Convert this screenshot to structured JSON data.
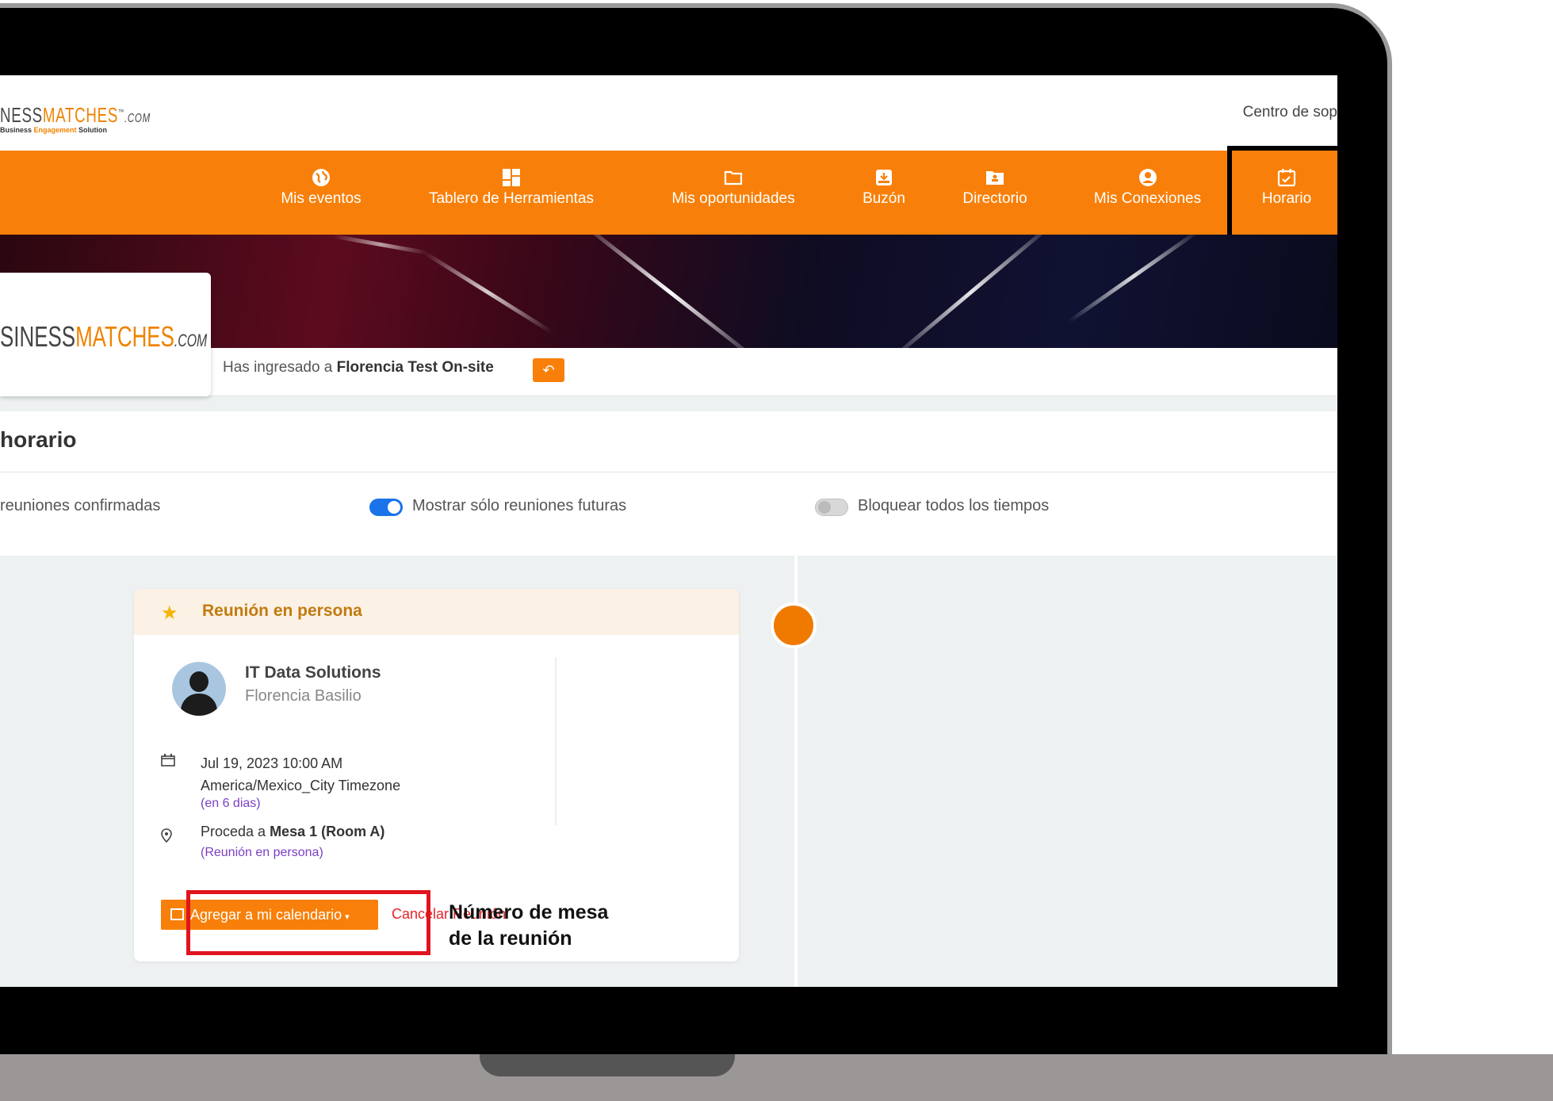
{
  "header": {
    "logo_left": "NESS",
    "logo_right": "MATCHES",
    "logo_tm": "™",
    "logo_com": ".COM",
    "logo_tagline_a": "Business ",
    "logo_tagline_b": "Engagement",
    "logo_tagline_c": " Solution",
    "support_link": "Centro de sop"
  },
  "nav": {
    "items": [
      {
        "label": "Mis eventos",
        "icon": "globe-icon"
      },
      {
        "label": "Tablero de Herramientas",
        "icon": "dashboard-icon"
      },
      {
        "label": "Mis oportunidades",
        "icon": "folder-icon"
      },
      {
        "label": "Buzón",
        "icon": "inbox-icon"
      },
      {
        "label": "Directorio",
        "icon": "directory-icon"
      },
      {
        "label": "Mis Conexiones",
        "icon": "user-circle-icon"
      },
      {
        "label": "Horario",
        "icon": "calendar-check-icon",
        "active": true
      }
    ]
  },
  "event": {
    "logo_left": "SINESS",
    "logo_right": "MATCHES",
    "logo_com": ".COM",
    "entered_prefix": "Has ingresado a ",
    "event_name": "Florencia Test On-site"
  },
  "schedule": {
    "title": "horario",
    "options": [
      {
        "label": "reuniones confirmadas"
      },
      {
        "label": "Mostrar sólo reuniones futuras",
        "enabled": true
      },
      {
        "label": "Bloquear todos los tiempos",
        "enabled": false
      }
    ]
  },
  "meeting": {
    "type_label": "Reunión en persona",
    "company": "IT Data Solutions",
    "contact": "Florencia Basilio",
    "datetime": "Jul 19, 2023 10:00 AM",
    "timezone": "America/Mexico_City Timezone",
    "relative": "(en 6 dias)",
    "location_prefix": "Proceda a ",
    "location_table": "Mesa 1 (Room A)",
    "location_type": "(Reunión en persona)",
    "add_calendar": "Agregar a mi calendario",
    "cancel": "Cancelar Reunión"
  },
  "annotation": {
    "line1": "Número de mesa",
    "line2": "de la reunión"
  },
  "colors": {
    "brand_orange": "#f8800a",
    "highlight_red": "#e0141e",
    "toggle_on": "#1a73e8",
    "link_purple": "#7b3fc4"
  }
}
